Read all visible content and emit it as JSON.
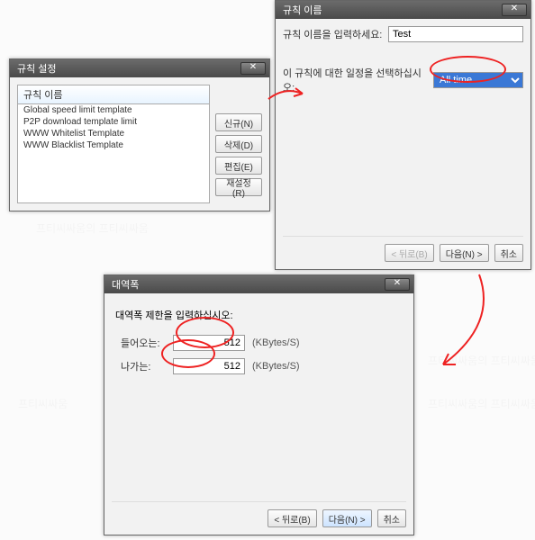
{
  "win1": {
    "title": "규칙 설정",
    "list_header": "규칙 이름",
    "items": [
      "Global speed limit template",
      "P2P download template limit",
      "WWW Whitelist Template",
      "WWW Blacklist Template"
    ],
    "buttons": {
      "new": "신규(N)",
      "delete": "삭제(D)",
      "edit": "편집(E)",
      "reset": "재설정(R)"
    }
  },
  "win2": {
    "title": "규칙 이름",
    "prompt_name": "규칙 이름을 입력하세요:",
    "name_value": "Test",
    "prompt_schedule": "이 규칙에 대한 일정을 선택하십시오:",
    "schedule_value": "All time",
    "buttons": {
      "back": "< 뒤로(B)",
      "next": "다음(N) >",
      "cancel": "취소"
    }
  },
  "win3": {
    "title": "대역폭",
    "prompt": "대역폭 제한을 입력하십시오:",
    "incoming_label": "들어오는:",
    "incoming_value": "512",
    "outgoing_label": "나가는:",
    "outgoing_value": "512",
    "unit": "(KBytes/S)",
    "buttons": {
      "back": "< 뒤로(B)",
      "next": "다음(N) >",
      "cancel": "취소"
    }
  },
  "close_glyph": "✕"
}
